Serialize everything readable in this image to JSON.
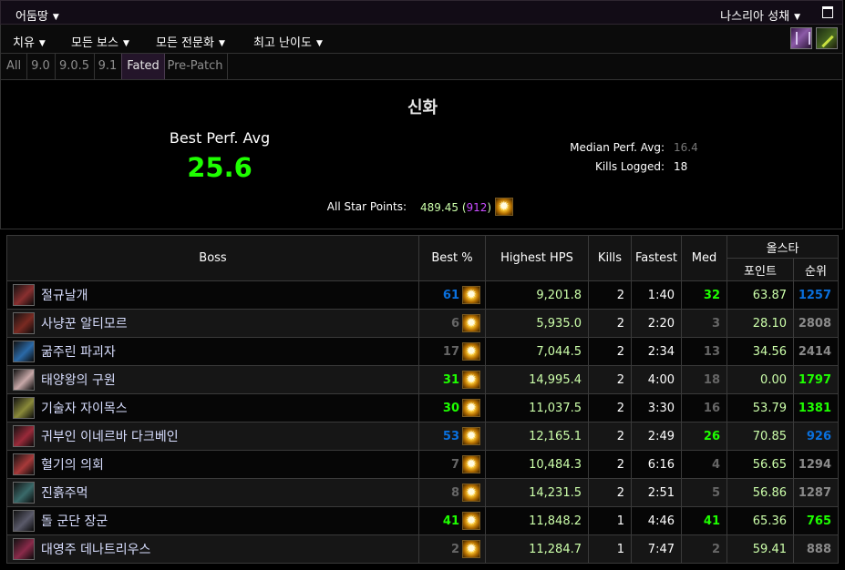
{
  "header": {
    "realm": "어둠땅",
    "raid": "나스리아 성채"
  },
  "filters": [
    "치유",
    "모든 보스",
    "모든 전문화",
    "최고 난이도"
  ],
  "tabs": [
    {
      "label": "All",
      "active": false
    },
    {
      "label": "9.0",
      "active": false
    },
    {
      "label": "9.0.5",
      "active": false
    },
    {
      "label": "9.1",
      "active": false
    },
    {
      "label": "Fated",
      "active": true
    },
    {
      "label": "Pre-Patch",
      "active": false
    }
  ],
  "summary": {
    "difficulty": "신화",
    "best_perf_label": "Best Perf. Avg",
    "best_perf_value": "25.6",
    "median_label": "Median Perf. Avg:",
    "median_value": "16.4",
    "kills_label": "Kills Logged:",
    "kills_value": "18",
    "star_label": "All Star Points:",
    "star_value": "489.45",
    "star_max": "912"
  },
  "table": {
    "headers": {
      "boss": "Boss",
      "best": "Best %",
      "hps": "Highest HPS",
      "kills": "Kills",
      "fastest": "Fastest",
      "med": "Med",
      "allstar": "올스타",
      "points": "포인트",
      "rank": "순위"
    },
    "rows": [
      {
        "name": "절규날개",
        "best": "61",
        "best_color": "#0a70dd",
        "hps": "9,201.8",
        "kills": "2",
        "fastest": "1:40",
        "med": "32",
        "med_color": "#1eff00",
        "points": "63.87",
        "rank": "1257",
        "rank_color": "#0a70dd",
        "icon": "bat-boss-icon",
        "icon_color": "#8a3030"
      },
      {
        "name": "사냥꾼 알티모르",
        "best": "6",
        "best_color": "#666666",
        "hps": "5,935.0",
        "kills": "2",
        "fastest": "2:20",
        "med": "3",
        "med_color": "#666666",
        "points": "28.10",
        "rank": "2808",
        "rank_color": "#8a8a8a",
        "icon": "hunter-boss-icon",
        "icon_color": "#7a2a22"
      },
      {
        "name": "굶주린 파괴자",
        "best": "17",
        "best_color": "#666666",
        "hps": "7,044.5",
        "kills": "2",
        "fastest": "2:34",
        "med": "13",
        "med_color": "#666666",
        "points": "34.56",
        "rank": "2414",
        "rank_color": "#8a8a8a",
        "icon": "destroyer-boss-icon",
        "icon_color": "#2a6aa8"
      },
      {
        "name": "태양왕의 구원",
        "best": "31",
        "best_color": "#1eff00",
        "hps": "14,995.4",
        "kills": "2",
        "fastest": "4:00",
        "med": "18",
        "med_color": "#666666",
        "points": "0.00",
        "rank": "1797",
        "rank_color": "#1eff00",
        "icon": "sun-king-boss-icon",
        "icon_color": "#c8a8a8"
      },
      {
        "name": "기술자 자이목스",
        "best": "30",
        "best_color": "#1eff00",
        "hps": "11,037.5",
        "kills": "2",
        "fastest": "3:30",
        "med": "16",
        "med_color": "#666666",
        "points": "53.79",
        "rank": "1381",
        "rank_color": "#1eff00",
        "icon": "artificer-boss-icon",
        "icon_color": "#8a8a3a"
      },
      {
        "name": "귀부인 이네르바 다크베인",
        "best": "53",
        "best_color": "#0a70dd",
        "hps": "12,165.1",
        "kills": "2",
        "fastest": "2:49",
        "med": "26",
        "med_color": "#1eff00",
        "points": "70.85",
        "rank": "926",
        "rank_color": "#0a70dd",
        "icon": "lady-boss-icon",
        "icon_color": "#9a2a3a"
      },
      {
        "name": "혈기의 의회",
        "best": "7",
        "best_color": "#666666",
        "hps": "10,484.3",
        "kills": "2",
        "fastest": "6:16",
        "med": "4",
        "med_color": "#666666",
        "points": "56.65",
        "rank": "1294",
        "rank_color": "#8a8a8a",
        "icon": "council-boss-icon",
        "icon_color": "#a83a3a"
      },
      {
        "name": "진흙주먹",
        "best": "8",
        "best_color": "#666666",
        "hps": "14,231.5",
        "kills": "2",
        "fastest": "2:51",
        "med": "5",
        "med_color": "#666666",
        "points": "56.86",
        "rank": "1287",
        "rank_color": "#8a8a8a",
        "icon": "sludgefist-boss-icon",
        "icon_color": "#3a6a6a"
      },
      {
        "name": "돌 군단 장군",
        "best": "41",
        "best_color": "#1eff00",
        "hps": "11,848.2",
        "kills": "1",
        "fastest": "4:46",
        "med": "41",
        "med_color": "#1eff00",
        "points": "65.36",
        "rank": "765",
        "rank_color": "#1eff00",
        "icon": "stone-legion-boss-icon",
        "icon_color": "#5a5a6a"
      },
      {
        "name": "대영주 데나트리우스",
        "best": "2",
        "best_color": "#666666",
        "hps": "11,284.7",
        "kills": "1",
        "fastest": "7:47",
        "med": "2",
        "med_color": "#666666",
        "points": "59.41",
        "rank": "888",
        "rank_color": "#8a8a8a",
        "icon": "denathrius-boss-icon",
        "icon_color": "#8a2a4a"
      }
    ]
  }
}
